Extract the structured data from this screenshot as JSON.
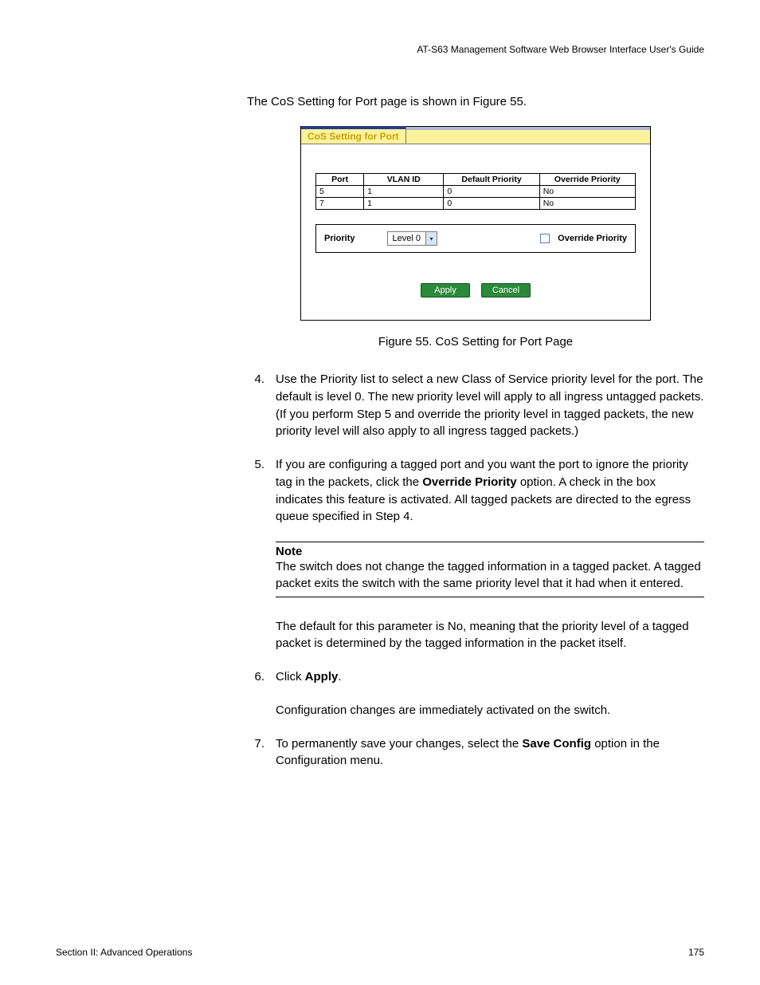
{
  "header": "AT-S63 Management Software Web Browser Interface User's Guide",
  "intro": "The CoS Setting for Port page is shown in Figure 55.",
  "panel": {
    "title": "CoS Setting for Port",
    "table": {
      "headers": [
        "Port",
        "VLAN ID",
        "Default Priority",
        "Override Priority"
      ],
      "rows": [
        [
          "5",
          "1",
          "0",
          "No"
        ],
        [
          "7",
          "1",
          "0",
          "No"
        ]
      ]
    },
    "controls": {
      "priority_label": "Priority",
      "select_value": "Level 0",
      "override_label": "Override Priority"
    },
    "buttons": {
      "apply": "Apply",
      "cancel": "Cancel"
    }
  },
  "figure_caption": "Figure 55. CoS Setting for Port Page",
  "step4": {
    "num": "4.",
    "text": "Use the Priority list to select a new Class of Service priority level for the port. The default is level 0. The new priority level will apply to all ingress untagged packets. (If you perform Step 5 and override the priority level in tagged packets, the new priority level will also apply to all ingress tagged packets.)"
  },
  "step5": {
    "num": "5.",
    "pre": "If you are configuring a tagged port and you want the port to ignore the priority tag in the packets, click the ",
    "bold": "Override Priority",
    "post": " option. A check in the box indicates this feature is activated. All tagged packets are directed to the egress queue specified in Step 4."
  },
  "note": {
    "title": "Note",
    "body": "The switch does not change the tagged information in a tagged packet. A tagged packet exits the switch with the same priority level that it had when it entered."
  },
  "after_note": "The default for this parameter is No, meaning that the priority level of a tagged packet is determined by the tagged information in the packet itself.",
  "step6": {
    "num": "6.",
    "pre": "Click ",
    "bold": "Apply",
    "post": "."
  },
  "step6_sub": "Configuration changes are immediately activated on the switch.",
  "step7": {
    "num": "7.",
    "pre": "To permanently save your changes, select the ",
    "bold": "Save Config",
    "post": " option in the Configuration menu."
  },
  "footer": {
    "left": "Section II: Advanced Operations",
    "right": "175"
  }
}
